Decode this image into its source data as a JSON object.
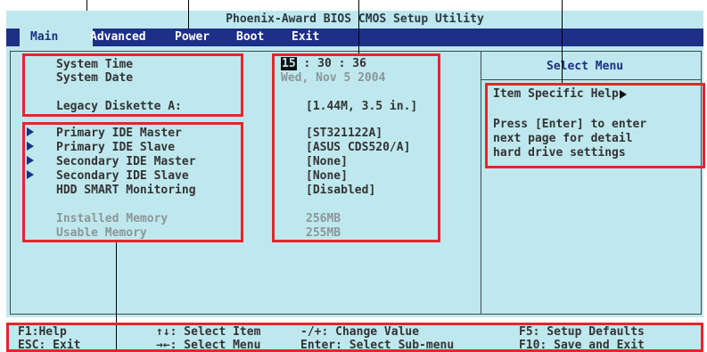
{
  "title": "Phoenix-Award BIOS CMOS Setup Utility",
  "menu": {
    "items": [
      {
        "label": "Main"
      },
      {
        "label": "Advanced"
      },
      {
        "label": "Power"
      },
      {
        "label": "Boot"
      },
      {
        "label": "Exit"
      }
    ]
  },
  "main": {
    "system_time_label": "System Time",
    "system_time_hour": "15",
    "system_time_rest": " : 30 : 36",
    "system_date_label": "System Date",
    "system_date_value": "Wed, Nov 5 2004",
    "legacy_label": "Legacy Diskette A:",
    "legacy_value": "[1.44M, 3.5 in.]",
    "items": [
      {
        "label": "Primary IDE Master",
        "value": "[ST321122A]"
      },
      {
        "label": "Primary IDE Slave",
        "value": "[ASUS CDS520/A]"
      },
      {
        "label": "Secondary IDE Master",
        "value": "[None]"
      },
      {
        "label": "Secondary IDE Slave",
        "value": "[None]"
      },
      {
        "label": "HDD SMART Monitoring",
        "value": "[Disabled]"
      }
    ],
    "installed_label": "Installed Memory",
    "installed_value": "256MB",
    "usable_label": "Usable Memory",
    "usable_value": "255MB"
  },
  "help": {
    "header": "Select Menu",
    "item_help": "Item Specific Help",
    "line1": "Press [Enter] to enter",
    "line2": "next page for detail",
    "line3": "hard drive settings"
  },
  "footer": {
    "f1": "F1:Help",
    "esc": "ESC: Exit",
    "select_item": "↑↓: Select Item",
    "select_menu": "→←: Select Menu",
    "change_value": "-/+: Change Value",
    "enter": "Enter: Select Sub-menu",
    "f5": "F5: Setup Defaults",
    "f10": "F10: Save and Exit"
  },
  "colors": {
    "background": "#bfe8ee",
    "menubar": "#1d2f86",
    "annotation": "#e8242b"
  }
}
